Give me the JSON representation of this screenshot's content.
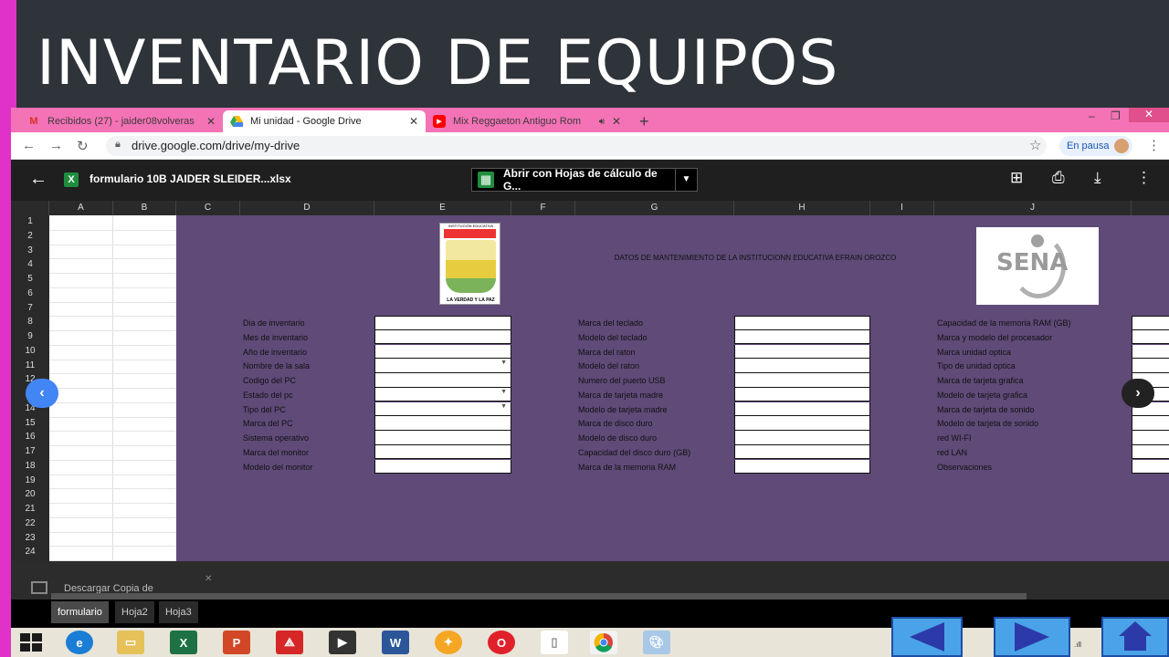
{
  "slide": {
    "title": "INVENTARIO DE EQUIPOS"
  },
  "browser": {
    "tabs": [
      {
        "label": "Recibidos (27) - jaider08volveras",
        "icon": "gmail-icon"
      },
      {
        "label": "Mi unidad - Google Drive",
        "icon": "drive-icon"
      },
      {
        "label": "Mix Reggaeton Antiguo Rom",
        "icon": "youtube-icon"
      }
    ],
    "url": "drive.google.com/drive/my-drive",
    "profile_status": "En pausa"
  },
  "viewer": {
    "file_name": "formulario 10B JAIDER SLEIDER...xlsx",
    "open_with": "Abrir con Hojas de cálculo de G..."
  },
  "sheet": {
    "columns": [
      "A",
      "B",
      "C",
      "D",
      "E",
      "F",
      "G",
      "H",
      "I",
      "J"
    ],
    "rows": [
      "1",
      "2",
      "3",
      "4",
      "5",
      "6",
      "7",
      "8",
      "9",
      "10",
      "11",
      "12",
      "13",
      "14",
      "15",
      "16",
      "17",
      "18",
      "19",
      "20",
      "21",
      "22",
      "23",
      "24"
    ],
    "header_text": "DATOS DE MANTENIMIENTO DE LA INSTITUCIONN EDUCATIVA EFRAIN OROZCO",
    "logo_left": {
      "top_text": "INSTITUCIÓN EDUCATIVA",
      "caption": "LA VERDAD Y LA PAZ"
    },
    "logo_right": {
      "text": "SENA"
    },
    "col1_labels": [
      "Dia de inventario",
      "Mes de inventario",
      "Año de inventario",
      "Nombre de la sala",
      "Codigo del PC",
      "Estado del pc",
      "Tipo del PC",
      "Marca del PC",
      "Sistema operativo",
      "Marca del monitor",
      "Modelo del monitor"
    ],
    "col2_labels": [
      "Marca del teclado",
      "Modelo del teclado",
      "Marca del raton",
      "Modelo del raton",
      "Numero del puerto USB",
      "Marca de tarjeta madre",
      "Modelo de tarjeta madre",
      "Marca de disco duro",
      "Modelo de disco duro",
      "Capacidad del disco duro (GB)",
      "Marca de la memoria RAM"
    ],
    "col3_labels": [
      "Capacidad de la memoria RAM (GB)",
      "Marca y modelo del procesador",
      "Marca unidad optica",
      "Tipo de unidad optica",
      "Marca de tarjeta grafica",
      "Modelo de tarjeta grafica",
      "Marca de tarjeta de sonido",
      "Modelo de tarjeta de sonido",
      "red WI-FI",
      "red LAN",
      "Observaciones"
    ]
  },
  "download": {
    "label": "Descargar Copia de"
  },
  "sheet_tabs": [
    "formulario",
    "Hoja2",
    "Hoja3"
  ]
}
